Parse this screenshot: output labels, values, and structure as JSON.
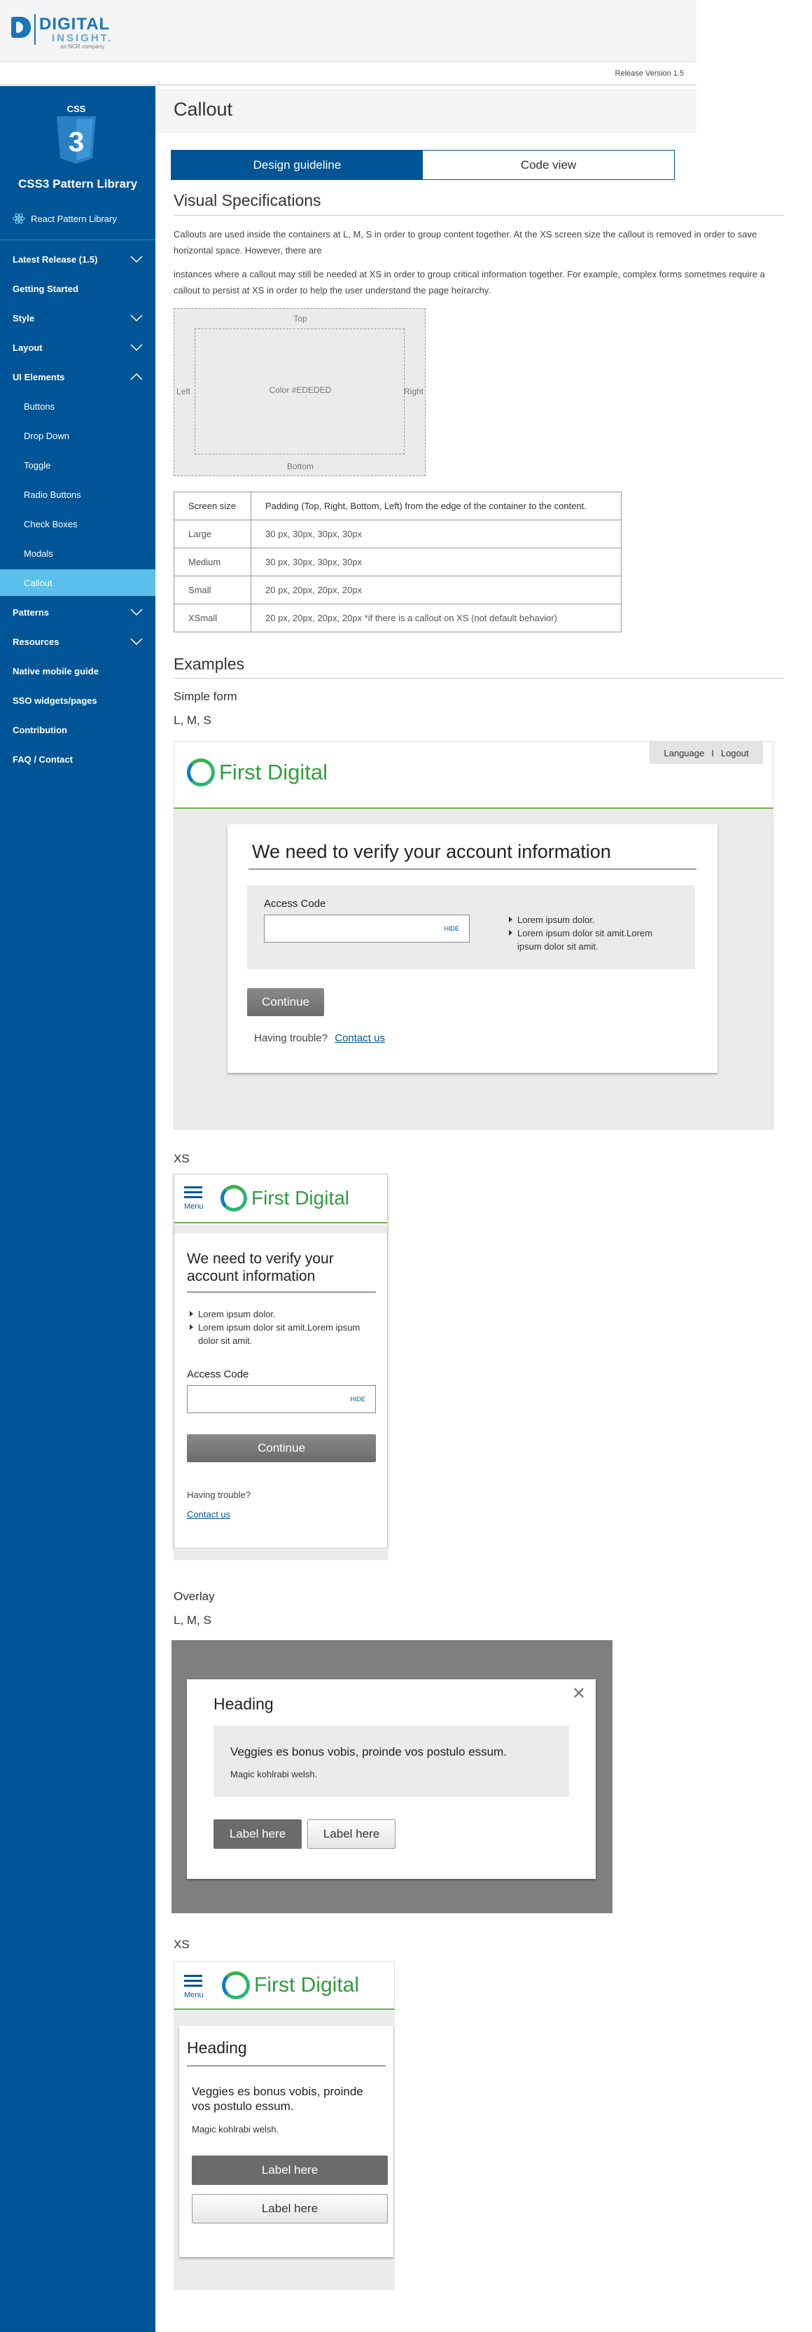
{
  "header": {
    "logo_word1": "DIGITAL",
    "logo_word2": "INSIGHT.",
    "logo_tagline": "an NCR company",
    "release_version": "Release Version 1.5"
  },
  "sidebar": {
    "css3_badge": "CSS",
    "css3_number": "3",
    "title": "CSS3 Pattern Library",
    "react_link": "React Pattern Library",
    "items": [
      {
        "label": "Latest Release (1.5)",
        "chevron": "down"
      },
      {
        "label": "Getting Started",
        "chevron": ""
      },
      {
        "label": "Style",
        "chevron": "down"
      },
      {
        "label": "Layout",
        "chevron": "down"
      },
      {
        "label": "UI Elements",
        "chevron": "up"
      },
      {
        "label": "Buttons",
        "chevron": ""
      },
      {
        "label": "Drop Down",
        "chevron": ""
      },
      {
        "label": "Toggle",
        "chevron": ""
      },
      {
        "label": "Radio Buttons",
        "chevron": ""
      },
      {
        "label": "Check Boxes",
        "chevron": ""
      },
      {
        "label": "Modals",
        "chevron": ""
      },
      {
        "label": "Callout",
        "chevron": ""
      },
      {
        "label": "Patterns",
        "chevron": "down"
      },
      {
        "label": "Resources",
        "chevron": "down"
      },
      {
        "label": "Native mobile guide",
        "chevron": ""
      },
      {
        "label": "SSO widgets/pages",
        "chevron": ""
      },
      {
        "label": "Contribution",
        "chevron": ""
      },
      {
        "label": "FAQ / Contact",
        "chevron": ""
      }
    ]
  },
  "page": {
    "title": "Callout",
    "tabs": [
      "Design guideline",
      "Code view"
    ],
    "visual_spec_heading": "Visual Specifications",
    "para1": "Callouts are used inside the containers at L, M, S in order to group content together. At the XS screen size the callout is removed in order to save horizontal space. However, there are",
    "para2": "instances where a callout may still be needed at XS in order to group critical information together. For example, complex forms sometmes require a callout to persist at XS in order to help the user understand the page heirarchy.",
    "spec": {
      "top": "Top",
      "left": "Left",
      "right": "Right",
      "bottom": "Bottom",
      "center": "Color #EDEDED"
    },
    "table": {
      "head": [
        "Screen size",
        "Padding (Top, Right, Bottom, Left) from the edge of the container to the content."
      ],
      "rows": [
        [
          "Large",
          "30 px, 30px, 30px, 30px"
        ],
        [
          "Medium",
          "30 px, 30px, 30px, 30px"
        ],
        [
          "Small",
          "20 px, 20px, 20px, 20px"
        ],
        [
          "XSmall",
          "20 px, 20px, 20px, 20px  *if there is a callout on XS (not default behavior)"
        ]
      ]
    },
    "examples_heading": "Examples",
    "simple_form": "Simple form",
    "lms": "L, M, S",
    "xs": "XS",
    "overlay": "Overlay"
  },
  "example1": {
    "language": "Language",
    "divider": "I",
    "logout": "Logout",
    "brand": "First Digital",
    "heading": "We need to verify your account information",
    "access_code": "Access Code",
    "hide": "HIDE",
    "bullet1": "Lorem ipsum dolor.",
    "bullet2": "Lorem ipsum dolor sit amit.Lorem ipsum dolor sit amit.",
    "continue": "Continue",
    "trouble": "Having trouble?",
    "contact": "Contact us"
  },
  "example2": {
    "menu": "Menu",
    "brand": "First Digital",
    "heading": "We need to verify your account information",
    "bullet1": "Lorem ipsum dolor.",
    "bullet2": "Lorem ipsum dolor sit amit.Lorem ipsum dolor sit amit.",
    "access_code": "Access Code",
    "hide": "HIDE",
    "continue": "Continue",
    "trouble": "Having trouble?",
    "contact": "Contact us"
  },
  "example3": {
    "close": "✕",
    "heading": "Heading",
    "callout_text": "Veggies es bonus vobis, proinde vos postulo essum.",
    "callout_sub": "Magic kohlrabi welsh.",
    "primary": "Label here",
    "secondary": "Label here"
  },
  "example4": {
    "menu": "Menu",
    "brand": "First Digital",
    "heading": "Heading",
    "text": "Veggies es bonus vobis, proinde vos postulo essum.",
    "sub": "Magic kohlrabi welsh.",
    "primary": "Label here",
    "secondary": "Label here"
  }
}
